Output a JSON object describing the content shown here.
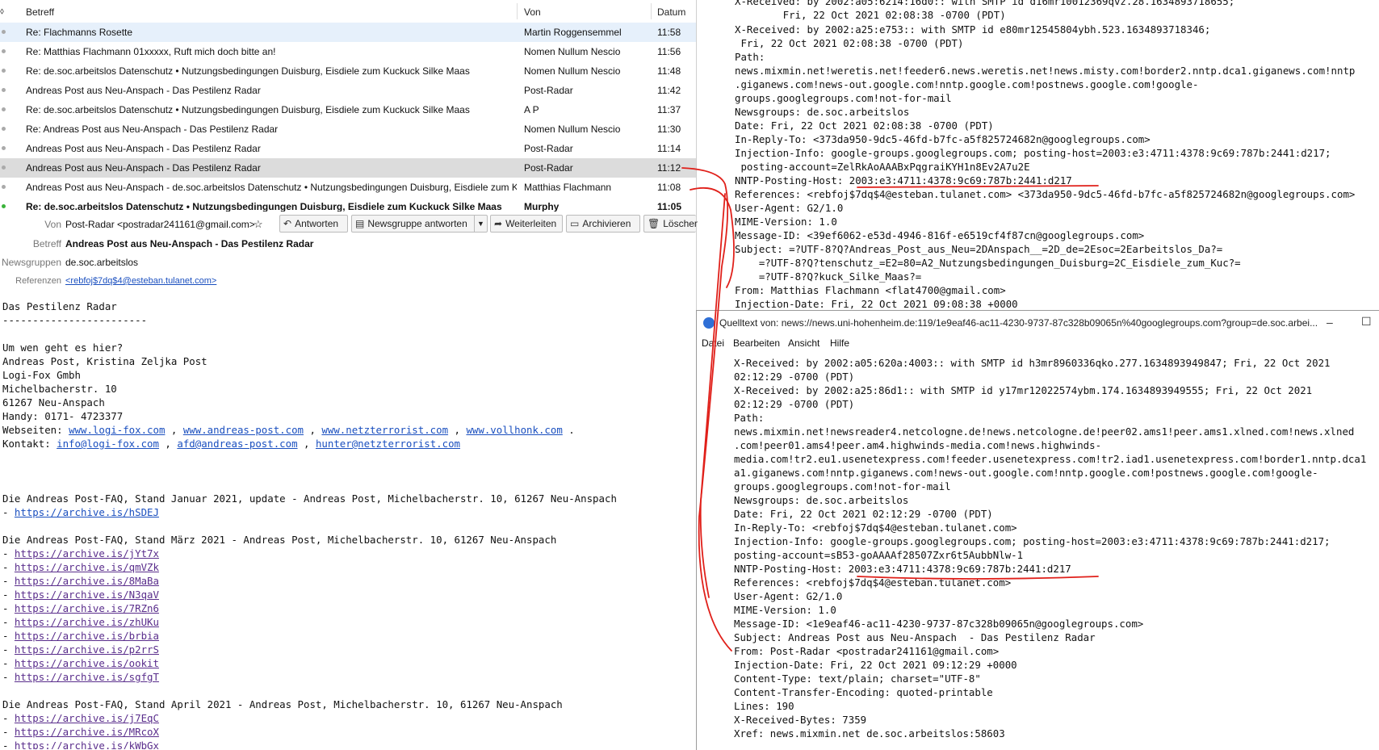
{
  "list": {
    "columns": {
      "subject": "Betreff",
      "from": "Von",
      "date": "Datum"
    },
    "rows": [
      {
        "subject": "Re: Flachmanns Rosette",
        "from": "Martin Roggensemmel",
        "time": "11:58"
      },
      {
        "subject": "Re: Matthias Flachmann 01xxxxx, Ruft mich doch bitte an!",
        "from": "Nomen Nullum Nescio",
        "time": "11:56"
      },
      {
        "subject": "Re: de.soc.arbeitslos Datenschutz • Nutzungsbedingungen Duisburg, Eisdiele zum Kuckuck Silke Maas",
        "from": "Nomen Nullum Nescio",
        "time": "11:48"
      },
      {
        "subject": "Andreas Post aus Neu-Anspach  - Das Pestilenz Radar",
        "from": "Post-Radar",
        "time": "11:42"
      },
      {
        "subject": "Re: de.soc.arbeitslos Datenschutz • Nutzungsbedingungen Duisburg, Eisdiele zum Kuckuck Silke Maas",
        "from": "A P",
        "time": "11:37"
      },
      {
        "subject": "Re: Andreas Post aus Neu-Anspach  - Das Pestilenz Radar",
        "from": "Nomen Nullum Nescio",
        "time": "11:30"
      },
      {
        "subject": "Andreas Post aus Neu-Anspach  - Das Pestilenz Radar",
        "from": "Post-Radar",
        "time": "11:14"
      },
      {
        "subject": "Andreas Post aus Neu-Anspach  - Das Pestilenz Radar",
        "from": "Post-Radar",
        "time": "11:12"
      },
      {
        "subject": "Andreas Post aus Neu-Anspach  - de.soc.arbeitslos Datenschutz • Nutzungsbedingungen Duisburg, Eisdiele zum Kuckuck S...",
        "from": "Matthias Flachmann",
        "time": "11:08"
      },
      {
        "subject": "Re: de.soc.arbeitslos Datenschutz • Nutzungsbedingungen Duisburg, Eisdiele zum Kuckuck Silke Maas",
        "from": "Murphy",
        "time": "11:05"
      }
    ]
  },
  "header": {
    "from_label": "Von",
    "from_value": "Post-Radar <postradar241161@gmail.com>",
    "star": "☆",
    "subject_label": "Betreff",
    "subject_value": "Andreas Post aus Neu-Anspach  - Das Pestilenz Radar",
    "groups_label": "Newsgruppen",
    "groups_value": "de.soc.arbeitslos",
    "refs_label": "Referenzen",
    "refs_value": "<rebfoj$7dq$4@esteban.tulanet.com>",
    "buttons": {
      "reply": "Antworten",
      "group_reply": "Newsgruppe antworten",
      "forward": "Weiterleiten",
      "archive": "Archivieren",
      "delete": "Löschen"
    }
  },
  "body": {
    "l01": "Das Pestilenz Radar",
    "l02": "------------------------",
    "l03": "Um wen geht es hier?",
    "l04": "Andreas Post, Kristina Zeljka Post",
    "l05": "Logi-Fox Gmbh",
    "l06": "Michelbacherstr. 10",
    "l07": "61267 Neu-Anspach",
    "l08": "Handy: 0171- 4723377",
    "web_label": "Webseiten: ",
    "web": [
      "www.logi-fox.com",
      "www.andreas-post.com",
      "www.netzterrorist.com",
      "www.vollhonk.com"
    ],
    "contact_label": "Kontakt: ",
    "contact": [
      "info@logi-fox.com",
      "afd@andreas-post.com",
      "hunter@netzterrorist.com"
    ],
    "faq1": "Die Andreas Post-FAQ, Stand Januar 2021, update - Andreas Post, Michelbacherstr. 10, 61267 Neu-Anspach",
    "faq1_links": [
      "https://archive.is/hSDEJ"
    ],
    "faq2": "Die Andreas Post-FAQ, Stand März 2021 - Andreas Post, Michelbacherstr. 10, 61267 Neu-Anspach",
    "faq2_links": [
      "https://archive.is/jYt7x",
      "https://archive.is/qmVZk",
      "https://archive.is/8MaBa",
      "https://archive.is/N3qaV",
      "https://archive.is/7RZn6",
      "https://archive.is/zhUKu",
      "https://archive.is/brbia",
      "https://archive.is/p2rrS",
      "https://archive.is/ookit",
      "https://archive.is/sgfgT"
    ],
    "faq3": "Die Andreas Post-FAQ, Stand April 2021 - Andreas Post, Michelbacherstr. 10, 61267 Neu-Anspach",
    "faq3_links": [
      "https://archive.is/j7EqC",
      "https://archive.is/MRcoX",
      "https://archive.is/kWbGx"
    ]
  },
  "source_top": [
    "X-Received: by 2002:a05:6214:16d0:: with SMTP id d16mr10012369qvz.28.1634893718655;",
    "        Fri, 22 Oct 2021 02:08:38 -0700 (PDT)",
    "X-Received: by 2002:a25:e753:: with SMTP id e80mr12545804ybh.523.1634893718346;",
    " Fri, 22 Oct 2021 02:08:38 -0700 (PDT)",
    "Path:",
    "news.mixmin.net!weretis.net!feeder6.news.weretis.net!news.misty.com!border2.nntp.dca1.giganews.com!nntp",
    ".giganews.com!news-out.google.com!nntp.google.com!postnews.google.com!google-",
    "groups.googlegroups.com!not-for-mail",
    "Newsgroups: de.soc.arbeitslos",
    "Date: Fri, 22 Oct 2021 02:08:38 -0700 (PDT)",
    "In-Reply-To: <373da950-9dc5-46fd-b7fc-a5f825724682n@googlegroups.com>",
    "Injection-Info: google-groups.googlegroups.com; posting-host=2003:e3:4711:4378:9c69:787b:2441:d217;",
    " posting-account=ZelRkAoAAABxPqgraiKYH1n8Ev2A7u2E",
    "NNTP-Posting-Host: 2003:e3:4711:4378:9c69:787b:2441:d217",
    "References: <rebfoj$7dq$4@esteban.tulanet.com> <373da950-9dc5-46fd-b7fc-a5f825724682n@googlegroups.com>",
    "User-Agent: G2/1.0",
    "MIME-Version: 1.0",
    "Message-ID: <39ef6062-e53d-4946-816f-e6519cf4f87cn@googlegroups.com>",
    "Subject: =?UTF-8?Q?Andreas_Post_aus_Neu=2DAnspach__=2D_de=2Esoc=2Earbeitslos_Da?=",
    "    =?UTF-8?Q?tenschutz_=E2=80=A2_Nutzungsbedingungen_Duisburg=2C_Eisdiele_zum_Kuc?=",
    "    =?UTF-8?Q?kuck_Silke_Maas?=",
    "From: Matthias Flachmann <flat4700@gmail.com>",
    "Injection-Date: Fri, 22 Oct 2021 09:08:38 +0000"
  ],
  "window2": {
    "title": "Quelltext von: news://news.uni-hohenheim.de:119/1e9eaf46-ac11-4230-9737-87c328b09065n%40googlegroups.com?group=de.soc.arbei...",
    "menu": [
      "Datei",
      "Bearbeiten",
      "Ansicht",
      "Hilfe"
    ],
    "minimize": "–",
    "maximize": "☐"
  },
  "source_bottom": [
    "X-Received: by 2002:a05:620a:4003:: with SMTP id h3mr8960336qko.277.1634893949847; Fri, 22 Oct 2021",
    "02:12:29 -0700 (PDT)",
    "X-Received: by 2002:a25:86d1:: with SMTP id y17mr12022574ybm.174.1634893949555; Fri, 22 Oct 2021",
    "02:12:29 -0700 (PDT)",
    "Path:",
    "news.mixmin.net!newsreader4.netcologne.de!news.netcologne.de!peer02.ams1!peer.ams1.xlned.com!news.xlned",
    ".com!peer01.ams4!peer.am4.highwinds-media.com!news.highwinds-",
    "media.com!tr2.eu1.usenetexpress.com!feeder.usenetexpress.com!tr2.iad1.usenetexpress.com!border1.nntp.dca1",
    "a1.giganews.com!nntp.giganews.com!news-out.google.com!nntp.google.com!postnews.google.com!google-",
    "groups.googlegroups.com!not-for-mail",
    "Newsgroups: de.soc.arbeitslos",
    "Date: Fri, 22 Oct 2021 02:12:29 -0700 (PDT)",
    "In-Reply-To: <rebfoj$7dq$4@esteban.tulanet.com>",
    "Injection-Info: google-groups.googlegroups.com; posting-host=2003:e3:4711:4378:9c69:787b:2441:d217;",
    "posting-account=sB53-goAAAAf28507Zxr6t5AubbNlw-1",
    "NNTP-Posting-Host: 2003:e3:4711:4378:9c69:787b:2441:d217",
    "References: <rebfoj$7dq$4@esteban.tulanet.com>",
    "User-Agent: G2/1.0",
    "MIME-Version: 1.0",
    "Message-ID: <1e9eaf46-ac11-4230-9737-87c328b09065n@googlegroups.com>",
    "Subject: Andreas Post aus Neu-Anspach  - Das Pestilenz Radar",
    "From: Post-Radar <postradar241161@gmail.com>",
    "Injection-Date: Fri, 22 Oct 2021 09:12:29 +0000",
    "Content-Type: text/plain; charset=\"UTF-8\"",
    "Content-Transfer-Encoding: quoted-printable",
    "Lines: 190",
    "X-Received-Bytes: 7359",
    "Xref: news.mixmin.net de.soc.arbeitslos:58603"
  ],
  "colors": {
    "annotation": "#e0201a",
    "link": "#1a4fbf",
    "visited": "#5a2e8c",
    "selected_row": "#dcdcdc"
  }
}
